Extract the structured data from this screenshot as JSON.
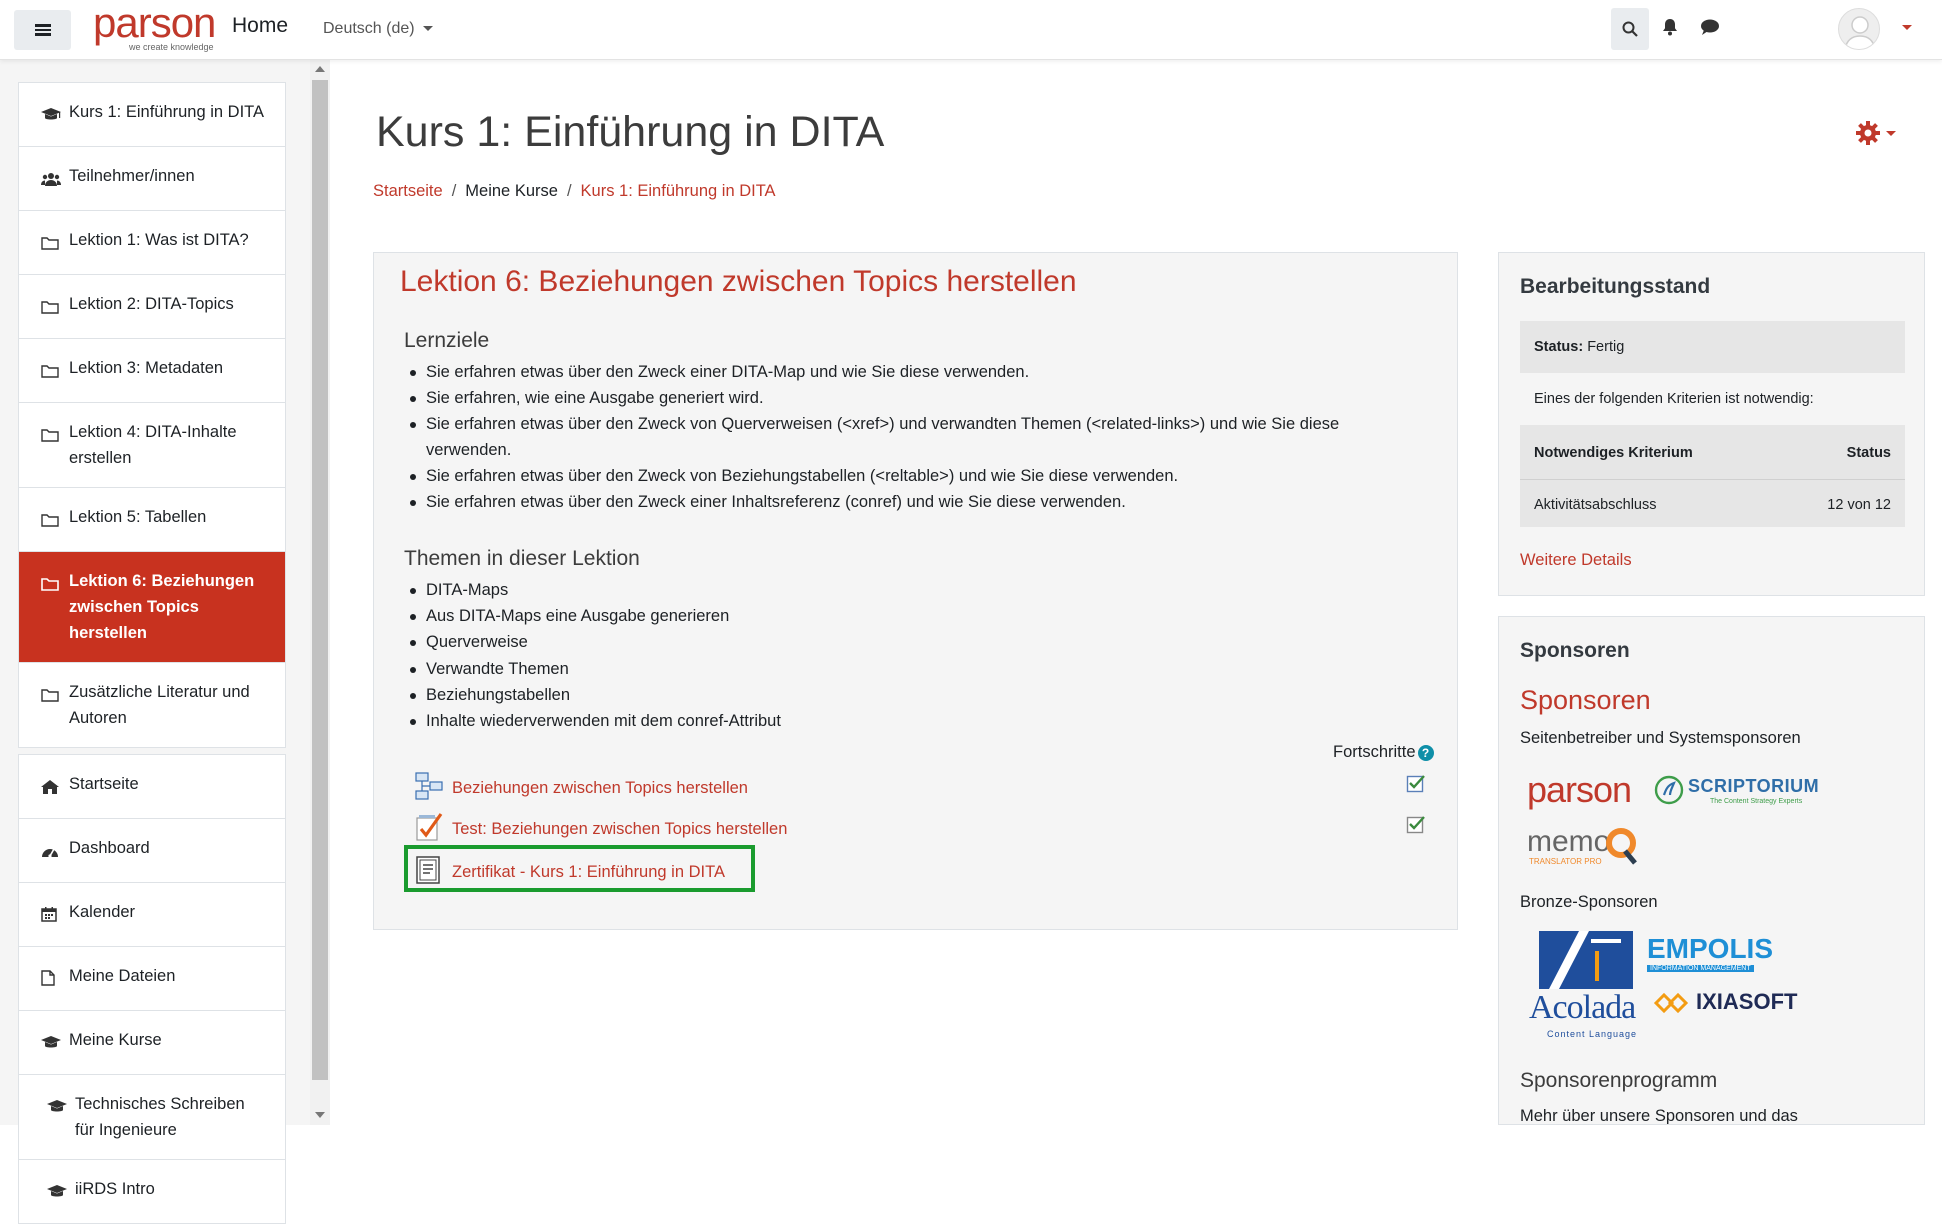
{
  "navbar": {
    "logo_text": "parson",
    "logo_tagline": "we create knowledge",
    "home_label": "Home",
    "language": "Deutsch (de)"
  },
  "drawer": {
    "course_items": [
      {
        "label": "Kurs 1: Einführung in DITA",
        "icon": "graduation-cap-icon"
      },
      {
        "label": "Teilnehmer/innen",
        "icon": "users-icon"
      },
      {
        "label": "Lektion 1: Was ist DITA?",
        "icon": "folder-icon"
      },
      {
        "label": "Lektion 2: DITA-Topics",
        "icon": "folder-icon"
      },
      {
        "label": "Lektion 3: Metadaten",
        "icon": "folder-icon"
      },
      {
        "label": "Lektion 4: DITA-Inhalte erstellen",
        "icon": "folder-icon"
      },
      {
        "label": "Lektion 5: Tabellen",
        "icon": "folder-icon"
      },
      {
        "label": "Lektion 6: Beziehungen zwischen Topics herstellen",
        "icon": "folder-icon",
        "active": true
      },
      {
        "label": "Zusätzliche Literatur und Autoren",
        "icon": "folder-icon"
      }
    ],
    "site_items": [
      {
        "label": "Startseite",
        "icon": "home-icon"
      },
      {
        "label": "Dashboard",
        "icon": "dashboard-icon"
      },
      {
        "label": "Kalender",
        "icon": "calendar-icon"
      },
      {
        "label": "Meine Dateien",
        "icon": "file-icon"
      },
      {
        "label": "Meine Kurse",
        "icon": "graduation-cap-icon"
      },
      {
        "label": "Technisches Schreiben für Ingenieure",
        "icon": "graduation-cap-icon"
      },
      {
        "label": "iiRDS Intro",
        "icon": "graduation-cap-icon"
      }
    ]
  },
  "page": {
    "title": "Kurs 1: Einführung in DITA",
    "breadcrumb": [
      "Startseite",
      "Meine Kurse",
      "Kurs 1: Einführung in DITA"
    ]
  },
  "section": {
    "title": "Lektion 6: Beziehungen zwischen Topics herstellen",
    "lernziele_heading": "Lernziele",
    "lernziele": [
      "Sie erfahren etwas über den Zweck einer DITA-Map und wie Sie diese verwenden.",
      "Sie erfahren, wie eine Ausgabe generiert wird.",
      "Sie erfahren etwas über den Zweck von Querverweisen (<xref>) und verwandten Themen (<related-links>) und wie Sie diese verwenden.",
      "Sie erfahren etwas über den Zweck von Beziehungstabellen (<reltable>) und wie Sie diese verwenden.",
      "Sie erfahren etwas über den Zweck einer Inhaltsreferenz (conref) und wie Sie diese verwenden."
    ],
    "themen_heading": "Themen in dieser Lektion",
    "themen": [
      "DITA-Maps",
      "Aus DITA-Maps eine Ausgabe generieren",
      "Querverweise",
      "Verwandte Themen",
      "Beziehungstabellen",
      "Inhalte wiederverwenden mit dem conref-Attribut"
    ],
    "progress_label": "Fortschritte",
    "activities": [
      {
        "label": "Beziehungen zwischen Topics herstellen",
        "icon": "book-icon",
        "completed": true
      },
      {
        "label": "Test: Beziehungen zwischen Topics herstellen",
        "icon": "quiz-icon",
        "completed": true
      },
      {
        "label": "Zertifikat - Kurs 1: Einführung in DITA",
        "icon": "certificate-icon",
        "highlighted": true
      }
    ]
  },
  "completion_block": {
    "title": "Bearbeitungsstand",
    "status_label": "Status:",
    "status_value": "Fertig",
    "note": "Eines der folgenden Kriterien ist notwendig:",
    "col_criterion": "Notwendiges Kriterium",
    "col_status": "Status",
    "criterion": "Aktivitätsabschluss",
    "criterion_status": "12 von 12",
    "details_link": "Weitere Details"
  },
  "sponsors_block": {
    "title": "Sponsoren",
    "heading": "Sponsoren",
    "text1": "Seitenbetreiber und Systemsponsoren",
    "text2": "Bronze-Sponsoren",
    "heading2": "Sponsorenprogramm",
    "text3": "Mehr über unsere Sponsoren und das",
    "logos": {
      "parson": "parson",
      "scriptorium": "SCRIPTORIUM",
      "scriptorium_tag": "The Content Strategy Experts",
      "memoq": "memo",
      "memoq_tag": "TRANSLATOR PRO",
      "acolada": "Acolada",
      "acolada_tag": "Content Language",
      "empolis": "EMPOLIS",
      "empolis_tag": "INFORMATION MANAGEMENT",
      "ixiasoft": "IXIASOFT"
    }
  },
  "colors": {
    "accent": "#c0392b",
    "active_bg": "#c8321f",
    "highlight": "#1a9b2e"
  }
}
